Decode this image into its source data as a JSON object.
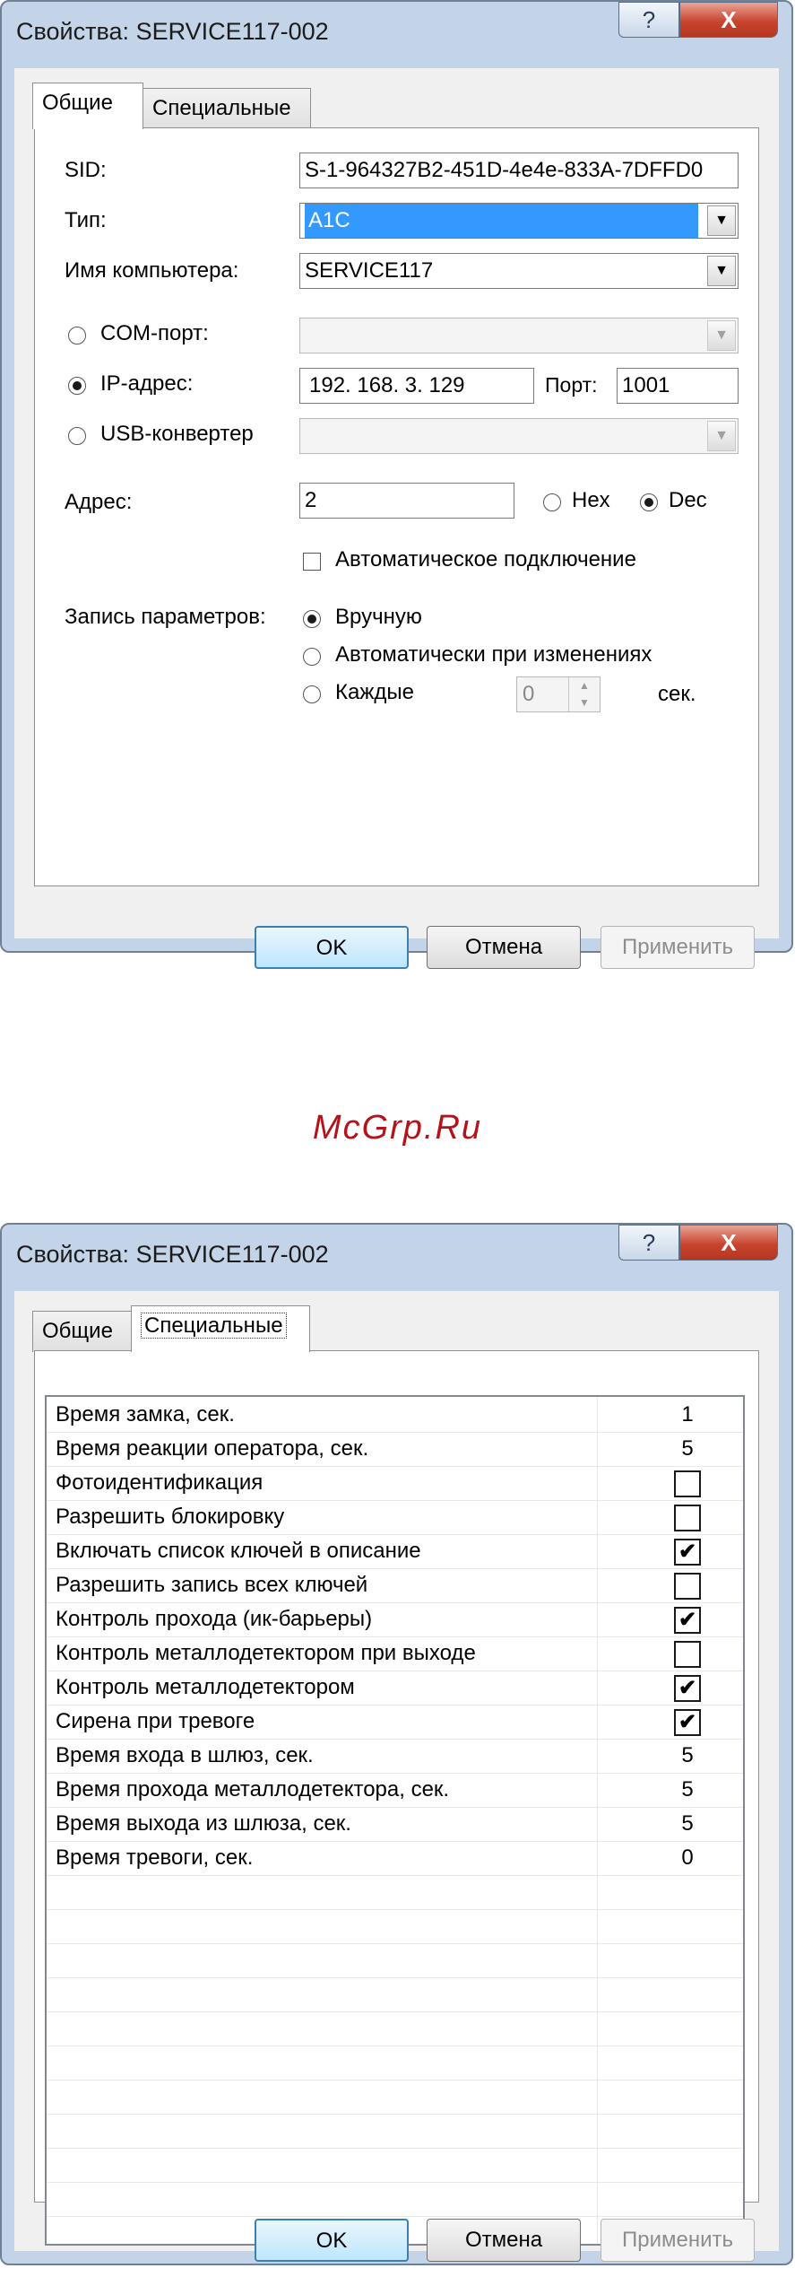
{
  "dialog1": {
    "title": "Свойства: SERVICE117-002",
    "help_glyph": "?",
    "close_glyph": "X",
    "tabs": [
      "Общие",
      "Специальные"
    ],
    "sid_label": "SID:",
    "sid_value": "S-1-964327B2-451D-4e4e-833A-7DFFD0",
    "type_label": "Тип:",
    "type_value": "A1C",
    "computer_label": "Имя компьютера:",
    "computer_value": "SERVICE117",
    "com_label": "COM-порт:",
    "ip_label": "IP-адрес:",
    "ip": [
      "192",
      "168",
      "3",
      "129"
    ],
    "port_label": "Порт:",
    "port_value": "1001",
    "usb_label": "USB-конвертер",
    "address_label": "Адрес:",
    "address_value": "2",
    "hex_label": "Hex",
    "dec_label": "Dec",
    "auto_connect_label": "Автоматическое подключение",
    "write_params_label": "Запись параметров:",
    "manual_label": "Вручную",
    "auto_changes_label": "Автоматически при изменениях",
    "every_label": "Каждые",
    "every_value": "0",
    "sec_label": "сек.",
    "ok": "OK",
    "cancel": "Отмена",
    "apply": "Применить"
  },
  "watermark": "McGrp.Ru",
  "dialog2": {
    "title": "Свойства: SERVICE117-002",
    "help_glyph": "?",
    "close_glyph": "X",
    "tabs": [
      "Общие",
      "Специальные"
    ],
    "rows": [
      {
        "name": "Время замка, сек.",
        "value": "1"
      },
      {
        "name": "Время реакции оператора, сек.",
        "value": "5"
      },
      {
        "name": "Фотоидентификация",
        "check": false
      },
      {
        "name": "Разрешить блокировку",
        "check": false
      },
      {
        "name": "Включать список ключей в описание",
        "check": true
      },
      {
        "name": "Разрешить запись всех ключей",
        "check": false
      },
      {
        "name": "Контроль прохода (ик-барьеры)",
        "check": true
      },
      {
        "name": "Контроль металлодетектором при выходе",
        "check": false
      },
      {
        "name": "Контроль металлодетектором",
        "check": true
      },
      {
        "name": "Сирена при тревоге",
        "check": true
      },
      {
        "name": "Время входа в шлюз, сек.",
        "value": "5"
      },
      {
        "name": "Время прохода металлодетектора, сек.",
        "value": "5"
      },
      {
        "name": "Время выхода из шлюза, сек.",
        "value": "5"
      },
      {
        "name": "Время тревоги, сек.",
        "value": "0"
      }
    ],
    "checkmark": "✔",
    "ok": "OK",
    "cancel": "Отмена",
    "apply": "Применить"
  }
}
